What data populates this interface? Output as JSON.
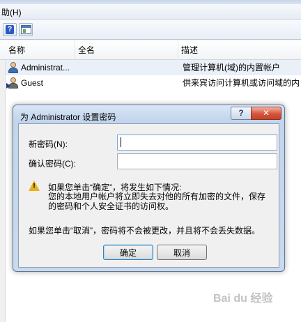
{
  "menubar": {
    "help_menu": "助(H)"
  },
  "toolbar": {
    "help_icon": "help-icon",
    "view_icon": "show-hide-pane-icon",
    "help_glyph": "?"
  },
  "list": {
    "columns": [
      "名称",
      "全名",
      "描述"
    ],
    "rows": [
      {
        "name": "Administrat...",
        "full_name": "",
        "description": "管理计算机(域)的内置帐户",
        "icon": "user-icon"
      },
      {
        "name": "Guest",
        "full_name": "",
        "description": "供来宾访问计算机或访问域的内",
        "icon": "user-icon"
      }
    ]
  },
  "dialog": {
    "title": "为 Administrator 设置密码",
    "help_button": "?",
    "close_button": "✕",
    "new_password_label": "新密码(N):",
    "confirm_password_label": "确认密码(C):",
    "new_password_value": "",
    "confirm_password_value": "",
    "warning_glyph": "!",
    "warning_line": "如果您单击“确定”，将发生如下情况:",
    "warning_detail": "您的本地用户帐户将立即失去对他的所有加密的文件，保存的密码和个人安全证书的访问权。",
    "cancel_note": "如果您单击“取消”，密码将不会被更改，并且将不会丢失数据。",
    "ok_button": "确定",
    "cancel_button": "取消"
  },
  "watermark": "Bai du 经验",
  "colors": {
    "selected_row": "#eaf0f8",
    "dialog_frame": "#c2d5ec",
    "close_button": "#c44229"
  }
}
